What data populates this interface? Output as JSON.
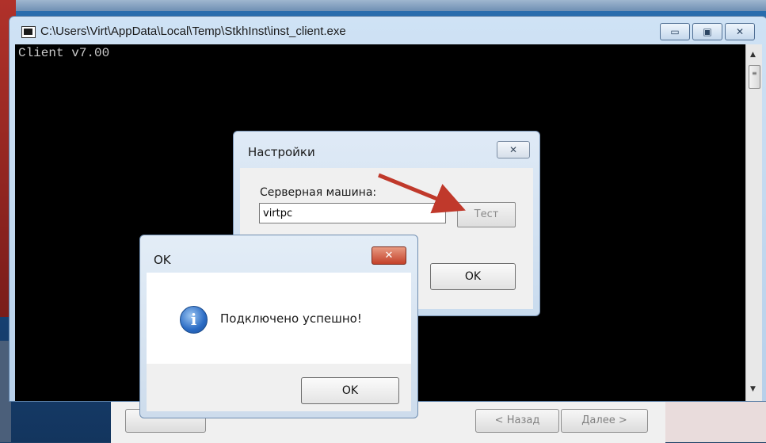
{
  "console": {
    "title": "C:\\Users\\Virt\\AppData\\Local\\Temp\\StkhInst\\inst_client.exe",
    "output_line": "Client v7.00",
    "minimize_glyph": "▭",
    "restore_glyph": "▣",
    "close_glyph": "✕"
  },
  "installer": {
    "back_label": "< Назад",
    "next_label": "Далее >"
  },
  "settings": {
    "title": "Настройки",
    "close_glyph": "✕",
    "server_label": "Серверная машина:",
    "server_value": "virtpc",
    "test_label": "Тест",
    "ok_label": "OK"
  },
  "message": {
    "title": "OK",
    "close_glyph": "✕",
    "icon_glyph": "i",
    "text": "Подключено успешно!",
    "ok_label": "OK"
  },
  "colors": {
    "arrow": "#c0392b"
  }
}
